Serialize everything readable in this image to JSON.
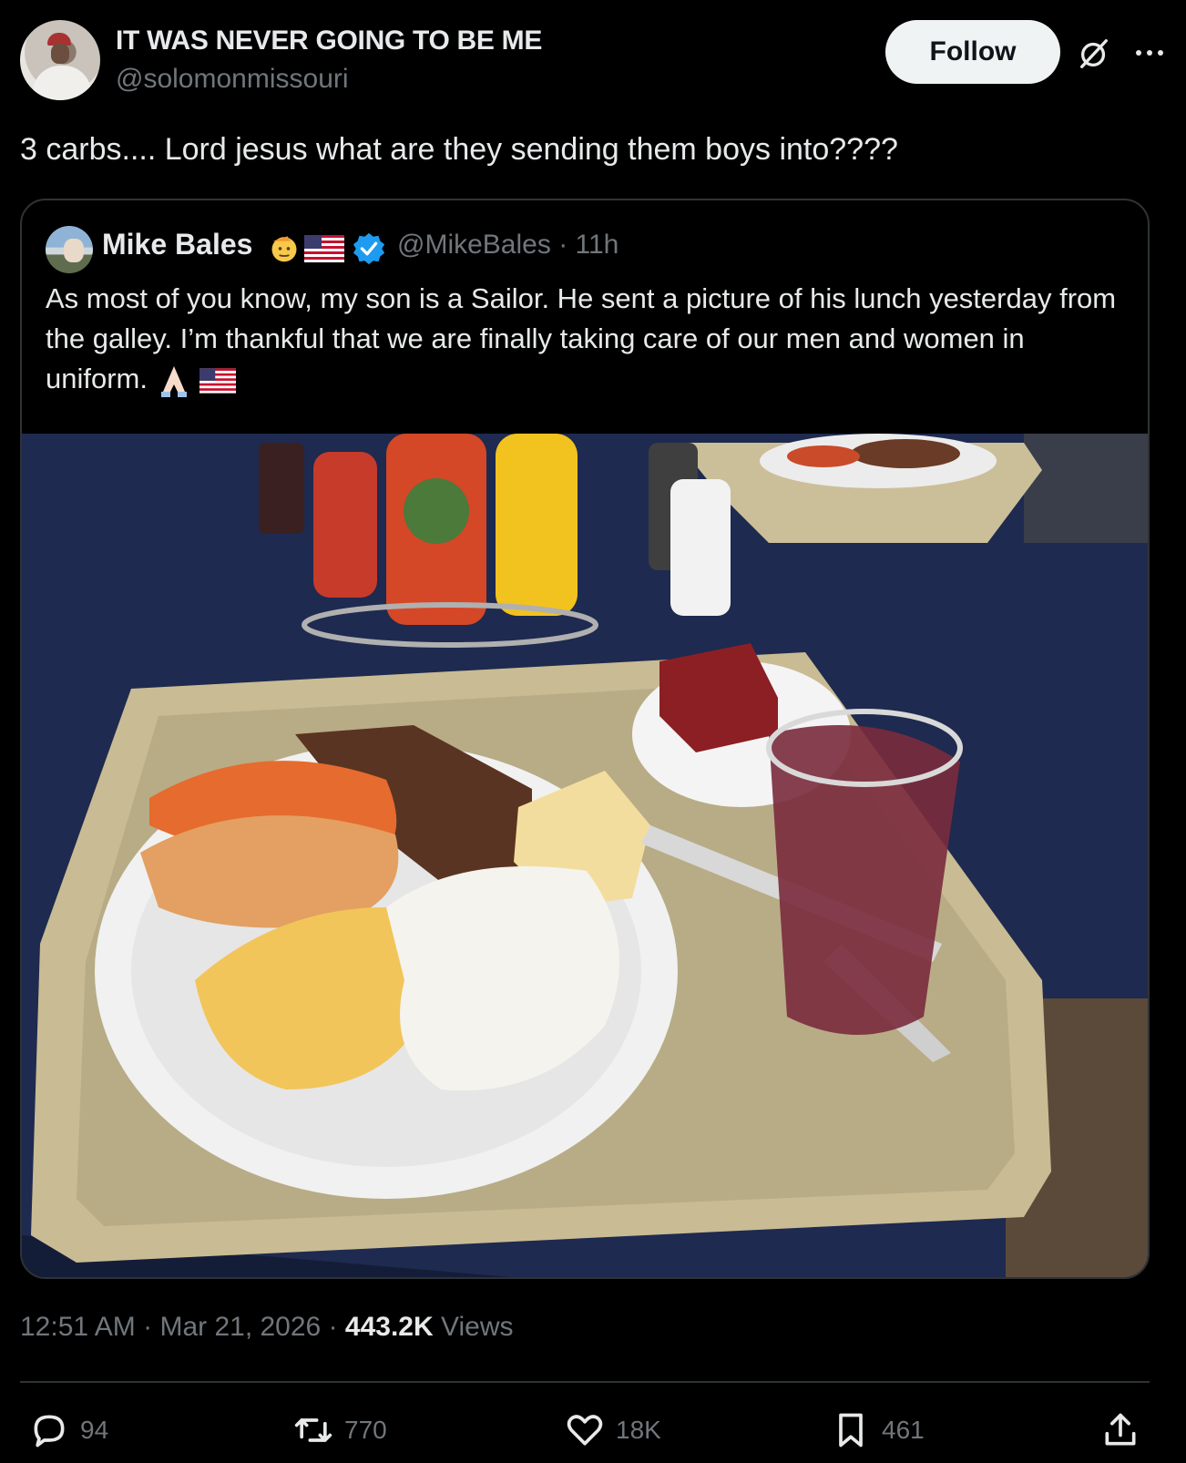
{
  "author": {
    "display_name": "IT WAS NEVER GOING TO BE ME",
    "handle": "@solomonmissouri"
  },
  "follow_label": "Follow",
  "tweet_text": "3 carbs.... Lord jesus what are they sending them boys into????",
  "quoted": {
    "display_name": "Mike Bales",
    "handle": "@MikeBales",
    "separator": "·",
    "age": "11h",
    "text": "As most of you know, my son is a Sailor. He sent a picture of his lunch yesterday from the galley. I’m thankful that we are finally taking care of our men and women in uniform.",
    "emojis": [
      "saluting-face",
      "us-flag",
      "folded-hands",
      "us-flag"
    ],
    "verified": true,
    "image_description_icon": "photo"
  },
  "meta": {
    "time": "12:51 AM",
    "sep1": "·",
    "date": "Mar 21, 2026",
    "sep2": "·",
    "views_count": "443.2K",
    "views_label": "Views"
  },
  "actions": {
    "replies": "94",
    "reposts": "770",
    "likes": "18K",
    "bookmarks": "461"
  },
  "colors": {
    "background": "#000000",
    "text": "#e7e9ea",
    "muted": "#71767b",
    "border": "#2f3336",
    "verified": "#1d9bf0",
    "follow_bg": "#eff3f4"
  }
}
